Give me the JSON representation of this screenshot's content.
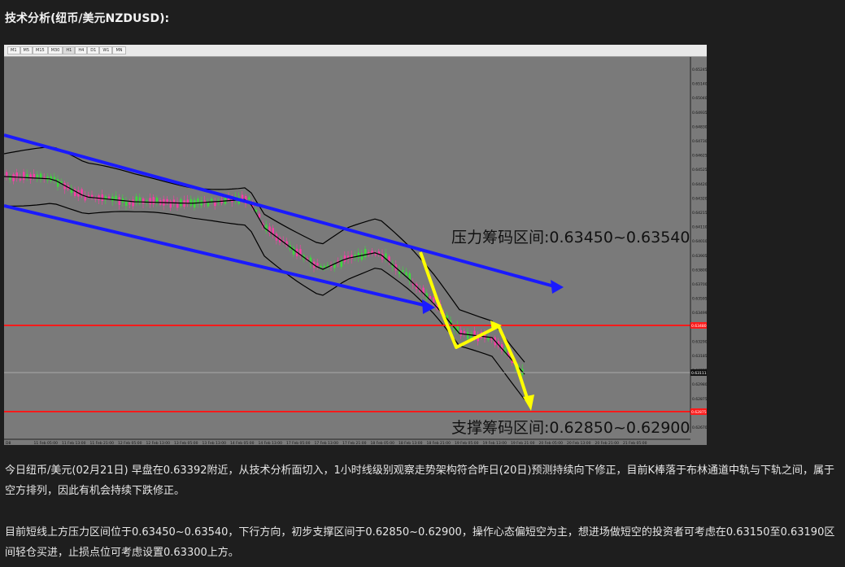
{
  "page": {
    "title": "技术分析(纽币/美元NZDUSD):",
    "paragraphs": [
      "今日纽币/美元(02月21日) 早盘在0.63392附近，从技术分析面切入，1小时线级别观察走势架构符合昨日(20日)预测持续向下修正，目前K棒落于布林通道中轨与下轨之间，属于空方排列，因此有机会持续下跌修正。",
      "目前短线上方压力区间位于0.63450~0.63540，下行方向，初步支撑区间于0.62850~0.62900，操作心态偏短空为主，想进场做短空的投资者可考虑在0.63150至0.63190区间轻仓买进，止损点位可考虑设置0.63300上方。"
    ]
  },
  "chart": {
    "timeframes": [
      "M1",
      "M5",
      "M15",
      "M30",
      "H1",
      "H4",
      "D1",
      "W1",
      "MN"
    ],
    "active_timeframe": "H1",
    "resistance_label": "压力筹码区间:0.63450~0.63540",
    "support_label": "支撑筹码区间:0.62850~0.62900",
    "price_ticks": [
      "0.65245",
      "0.65140",
      "0.65040",
      "0.64935",
      "0.64830",
      "0.64730",
      "0.64625",
      "0.64525",
      "0.64420",
      "0.64320",
      "0.64215",
      "0.64110",
      "0.64010",
      "0.63905",
      "0.63800",
      "0.63700",
      "0.63595",
      "0.63499",
      "0.63390",
      "0.63290",
      "0.63185",
      "0.63080",
      "0.62980",
      "0.62875",
      "0.62775",
      "0.62670"
    ],
    "current_price_tag": "0.63111",
    "resistance_tag": "0.63480",
    "support_tag": "0.62875",
    "time_ticks": [
      "D8",
      "11 Feb 05:00",
      "11 Feb 13:00",
      "11 Feb 21:00",
      "12 Feb 05:00",
      "12 Feb 13:00",
      "13 Feb 05:00",
      "13 Feb 13:00",
      "14 Feb 05:00",
      "14 Feb 13:00",
      "17 Feb 05:00",
      "17 Feb 13:00",
      "17 Feb 21:00",
      "18 Feb 05:00",
      "18 Feb 13:00",
      "18 Feb 21:00",
      "19 Feb 05:00",
      "19 Feb 13:00",
      "19 Feb 21:00",
      "20 Feb 05:00",
      "20 Feb 13:00",
      "20 Feb 21:00",
      "21 Feb 05:00"
    ],
    "colors": {
      "background": "#7a7a7a",
      "channel": "#1a1aff",
      "horizontal": "#ff1a1a",
      "arrow": "#ffff00",
      "bull": "#3cdc3c",
      "bear": "#ff3aa8",
      "bands": "#000000"
    }
  }
}
